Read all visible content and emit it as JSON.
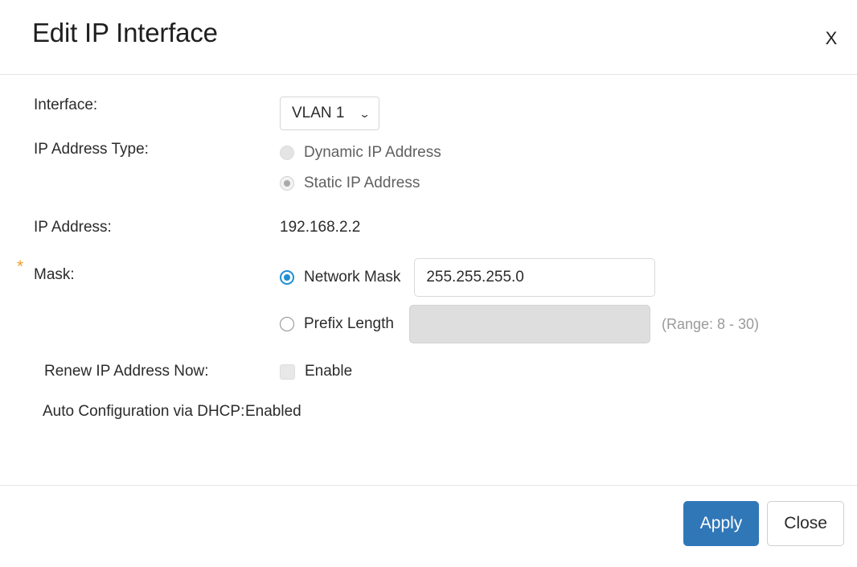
{
  "dialog": {
    "title": "Edit IP Interface",
    "close_label": "X"
  },
  "form": {
    "interface": {
      "label": "Interface:",
      "selected": "VLAN 1",
      "chevron": "chevron-down-icon"
    },
    "ip_address_type": {
      "label": "IP Address Type:",
      "options": [
        {
          "label": "Dynamic IP Address",
          "selected": false,
          "disabled": true
        },
        {
          "label": "Static IP Address",
          "selected": true,
          "disabled": true
        }
      ]
    },
    "ip_address": {
      "label": "IP Address:",
      "value": "192.168.2.2"
    },
    "mask": {
      "label": "Mask:",
      "required_marker": "*",
      "network_mask": {
        "radio_label": "Network Mask",
        "selected": true,
        "value": "255.255.255.0",
        "placeholder": ""
      },
      "prefix_length": {
        "radio_label": "Prefix Length",
        "selected": false,
        "value": "",
        "placeholder": "",
        "disabled": true,
        "hint": "(Range: 8 - 30)"
      }
    },
    "renew_ip": {
      "label": "Renew IP Address Now:",
      "checkbox_label": "Enable",
      "checked": false,
      "disabled": true
    },
    "auto_config": {
      "label": "Auto Configuration via DHCP:",
      "value": "Enabled"
    }
  },
  "footer": {
    "apply_label": "Apply",
    "close_label": "Close"
  },
  "colors": {
    "primary": "#3077b8",
    "radio_active": "#1e8fd5",
    "required_star": "#f2a024",
    "divider": "#e6e6e6"
  }
}
